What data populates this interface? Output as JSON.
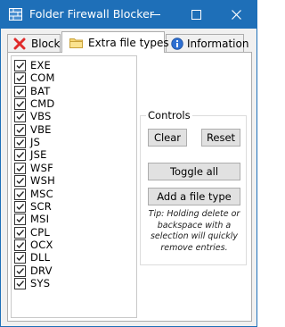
{
  "window": {
    "title": "Folder Firewall Blocker",
    "accent_color": "#1e6fb8",
    "icons": {
      "app": "shield-wall-icon",
      "minimize": "minimize-icon",
      "maximize": "maximize-icon",
      "close": "close-icon"
    }
  },
  "tabs": [
    {
      "label": "Block",
      "icon": "red-x-icon",
      "selected": false
    },
    {
      "label": "Extra file types",
      "icon": "folder-icon",
      "selected": true
    },
    {
      "label": "Information",
      "icon": "info-icon",
      "selected": false
    }
  ],
  "file_types": [
    {
      "label": "EXE",
      "checked": true
    },
    {
      "label": "COM",
      "checked": true
    },
    {
      "label": "BAT",
      "checked": true
    },
    {
      "label": "CMD",
      "checked": true
    },
    {
      "label": "VBS",
      "checked": true
    },
    {
      "label": "VBE",
      "checked": true
    },
    {
      "label": "JS",
      "checked": true
    },
    {
      "label": "JSE",
      "checked": true
    },
    {
      "label": "WSF",
      "checked": true
    },
    {
      "label": "WSH",
      "checked": true
    },
    {
      "label": "MSC",
      "checked": true
    },
    {
      "label": "SCR",
      "checked": true
    },
    {
      "label": "MSI",
      "checked": true
    },
    {
      "label": "CPL",
      "checked": true
    },
    {
      "label": "OCX",
      "checked": true
    },
    {
      "label": "DLL",
      "checked": true
    },
    {
      "label": "DRV",
      "checked": true
    },
    {
      "label": "SYS",
      "checked": true
    }
  ],
  "controls": {
    "title": "Controls",
    "clear_label": "Clear",
    "reset_label": "Reset",
    "toggle_all_label": "Toggle all",
    "add_file_type_label": "Add a file type",
    "tip": "Tip: Holding delete or backspace with a selection will quickly remove entries."
  }
}
